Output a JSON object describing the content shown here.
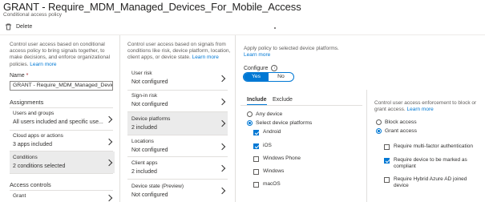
{
  "header": {
    "title": "GRANT - Require_MDM_Managed_Devices_For_Mobile_Access",
    "subtitle": "Conditional access policy",
    "delete_label": "Delete"
  },
  "col1": {
    "description": "Control user access based on conditional access policy to bring signals together, to make decisions, and enforce organizational policies.",
    "learn_more": "Learn more",
    "name_label": "Name",
    "name_required": "*",
    "name_value": "GRANT - Require_MDM_Managed_Device...",
    "assignments_heading": "Assignments",
    "items": [
      {
        "label": "Users and groups",
        "value": "All users included and specific use..."
      },
      {
        "label": "Cloud apps or actions",
        "value": "3 apps included"
      },
      {
        "label": "Conditions",
        "value": "2 conditions selected"
      }
    ],
    "access_controls_heading": "Access controls",
    "grant_label": "Grant"
  },
  "col2": {
    "description": "Control user access based on signals from conditions like risk, device platform, location, client apps, or device state.",
    "learn_more": "Learn more",
    "items": [
      {
        "label": "User risk",
        "value": "Not configured"
      },
      {
        "label": "Sign-in risk",
        "value": "Not configured"
      },
      {
        "label": "Device platforms",
        "value": "2 included"
      },
      {
        "label": "Locations",
        "value": "Not configured"
      },
      {
        "label": "Client apps",
        "value": "2 included"
      },
      {
        "label": "Device state (Preview)",
        "value": "Not configured"
      }
    ]
  },
  "col3": {
    "description": "Apply policy to selected device platforms.",
    "learn_more": "Learn more",
    "configure_label": "Configure",
    "toggle_yes": "Yes",
    "toggle_no": "No",
    "tab_include": "Include",
    "tab_exclude": "Exclude",
    "radio_any": "Any device",
    "radio_select": "Select device platforms",
    "platforms": [
      {
        "label": "Android",
        "checked": true
      },
      {
        "label": "iOS",
        "checked": true
      },
      {
        "label": "Windows Phone",
        "checked": false
      },
      {
        "label": "Windows",
        "checked": false
      },
      {
        "label": "macOS",
        "checked": false
      }
    ]
  },
  "col4": {
    "description": "Control user access enforcement to block or grant access.",
    "learn_more": "Learn more",
    "radio_block": "Block access",
    "radio_grant": "Grant access",
    "controls": [
      {
        "label": "Require multi-factor authentication",
        "checked": false
      },
      {
        "label": "Require device to be marked as compliant",
        "checked": true
      },
      {
        "label": "Require Hybrid Azure AD joined device",
        "checked": false
      }
    ]
  },
  "colors": {
    "accent": "#0078d4",
    "selected_bg": "#ebebeb",
    "required": "#a4262c"
  }
}
